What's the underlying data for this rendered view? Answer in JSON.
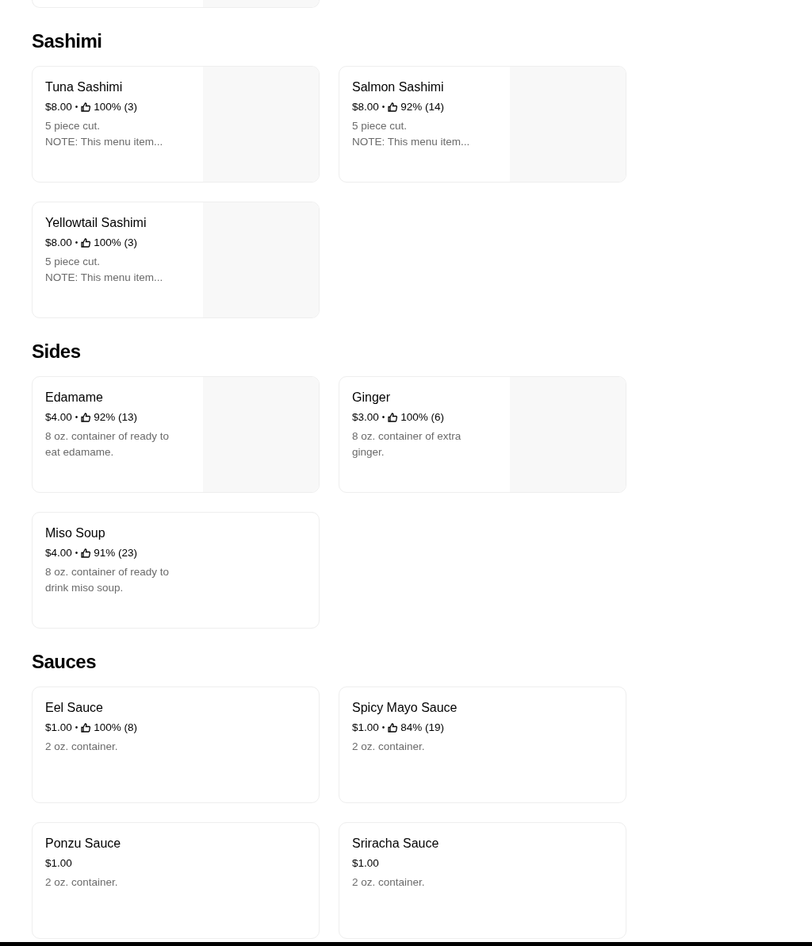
{
  "top_card": {
    "has_image": true
  },
  "sections": [
    {
      "heading": "Sashimi",
      "items": [
        {
          "name": "Tuna Sashimi",
          "price": "$8.00",
          "separator": "•",
          "rating": "100% (3)",
          "description": [
            "5 piece cut.",
            "NOTE: This menu item..."
          ],
          "has_image": true
        },
        {
          "name": "Salmon Sashimi",
          "price": "$8.00",
          "separator": "•",
          "rating": "92% (14)",
          "description": [
            "5 piece cut.",
            "NOTE: This menu item..."
          ],
          "has_image": true
        },
        {
          "name": "Yellowtail Sashimi",
          "price": "$8.00",
          "separator": "•",
          "rating": "100% (3)",
          "description": [
            "5 piece cut.",
            "NOTE: This menu item..."
          ],
          "has_image": true
        }
      ]
    },
    {
      "heading": "Sides",
      "items": [
        {
          "name": "Edamame",
          "price": "$4.00",
          "separator": "•",
          "rating": "92% (13)",
          "description": [
            "8 oz. container of ready to eat edamame."
          ],
          "has_image": true
        },
        {
          "name": "Ginger",
          "price": "$3.00",
          "separator": "•",
          "rating": "100% (6)",
          "description": [
            "8 oz. container of extra ginger."
          ],
          "has_image": true
        },
        {
          "name": "Miso Soup",
          "price": "$4.00",
          "separator": "•",
          "rating": "91% (23)",
          "description": [
            "8 oz. container of ready to drink miso soup."
          ],
          "has_image": false
        }
      ]
    },
    {
      "heading": "Sauces",
      "items": [
        {
          "name": "Eel Sauce",
          "price": "$1.00",
          "separator": "•",
          "rating": "100% (8)",
          "description": [
            "2 oz. container."
          ],
          "has_image": false
        },
        {
          "name": "Spicy Mayo Sauce",
          "price": "$1.00",
          "separator": "•",
          "rating": "84% (19)",
          "description": [
            "2 oz. container."
          ],
          "has_image": false
        },
        {
          "name": "Ponzu Sauce",
          "price": "$1.00",
          "description": [
            "2 oz. container."
          ],
          "has_image": false
        },
        {
          "name": "Sriracha Sauce",
          "price": "$1.00",
          "description": [
            "2 oz. container."
          ],
          "has_image": false
        }
      ]
    }
  ]
}
